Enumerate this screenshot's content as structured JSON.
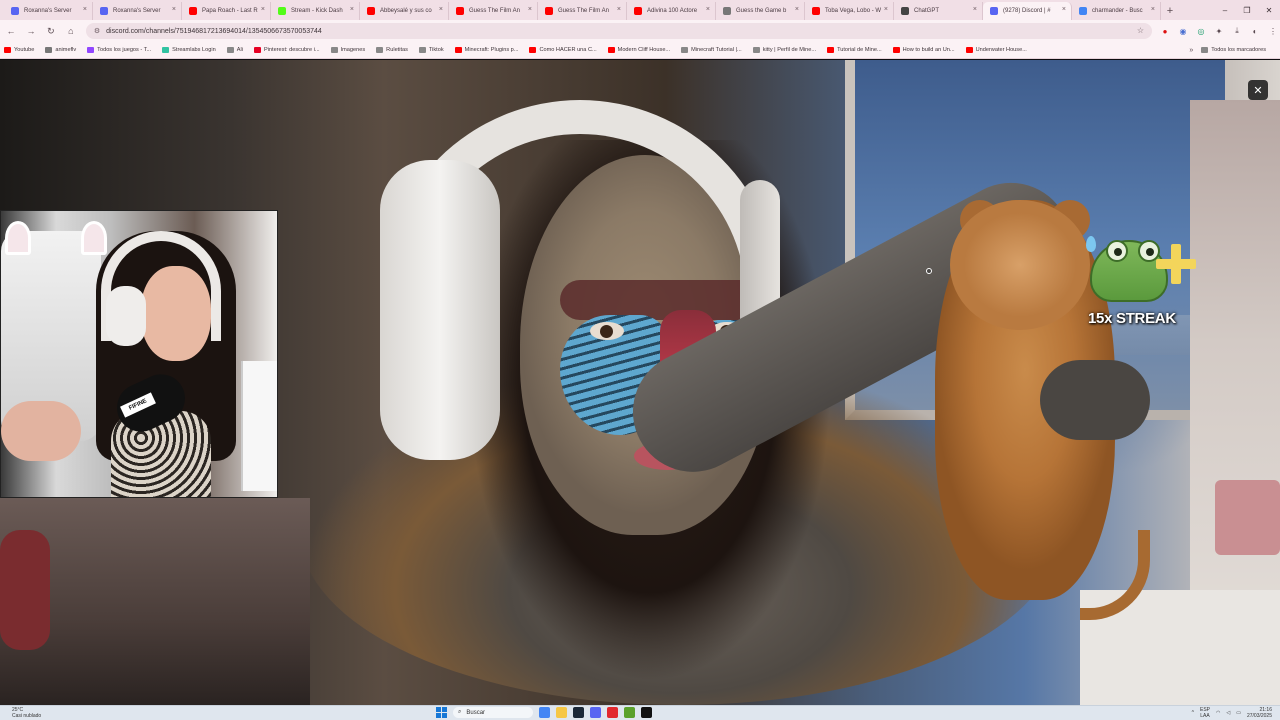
{
  "browser": {
    "tabs": [
      {
        "label": "Roxanna's Server",
        "color": "#5865f2"
      },
      {
        "label": "Roxanna's Server",
        "color": "#5865f2"
      },
      {
        "label": "Papa Roach - Last R",
        "color": "#ff0000"
      },
      {
        "label": "Stream - Kick Dash",
        "color": "#53fc18"
      },
      {
        "label": "Abbeysalé y sus co",
        "color": "#ff0000"
      },
      {
        "label": "Guess The Film An",
        "color": "#ff0000"
      },
      {
        "label": "Guess The Film An",
        "color": "#ff0000"
      },
      {
        "label": "Adivina 100 Actore",
        "color": "#ff0000"
      },
      {
        "label": "Guess the Game b",
        "color": "#777777"
      },
      {
        "label": "Toba Vega, Lobo - W",
        "color": "#ff0000"
      },
      {
        "label": "ChatGPT",
        "color": "#444444"
      },
      {
        "label": "(9278) Discord | #",
        "color": "#5865f2",
        "active": true
      },
      {
        "label": "charmander - Busc",
        "color": "#4285f4"
      }
    ],
    "url": "discord.com/channels/751946817213694014/1354506673570053744",
    "window_controls": {
      "minimize": "–",
      "maximize": "❐",
      "close": "✕"
    }
  },
  "bookmarks": {
    "items": [
      {
        "label": "Youtube",
        "color": "#ff0000"
      },
      {
        "label": "animeflv",
        "color": "#777777"
      },
      {
        "label": "Todos los juegos - T...",
        "color": "#9146ff"
      },
      {
        "label": "Streamlabs Login",
        "color": "#31c3a2"
      },
      {
        "label": "Ali",
        "color": "#888888"
      },
      {
        "label": "Pinterest: descubre i...",
        "color": "#e60023"
      },
      {
        "label": "Imagenes",
        "color": "#888888"
      },
      {
        "label": "Ruletitas",
        "color": "#888888"
      },
      {
        "label": "Tiktok",
        "color": "#888888"
      },
      {
        "label": "Minecraft: Plugins p...",
        "color": "#ff0000"
      },
      {
        "label": "Como HACER una C...",
        "color": "#ff0000"
      },
      {
        "label": "Modern Cliff House...",
        "color": "#ff0000"
      },
      {
        "label": "Minecraft Tutorial |...",
        "color": "#888888"
      },
      {
        "label": "kitty | Perfil de Mine...",
        "color": "#888888"
      },
      {
        "label": "Tutorial de Mine...",
        "color": "#ff0000"
      },
      {
        "label": "How to build an Un...",
        "color": "#ff0000"
      },
      {
        "label": "Underwater House...",
        "color": "#ff0000"
      }
    ],
    "more": "»",
    "all_label": "Todos los marcadores"
  },
  "viewer": {
    "close_icon": "✕",
    "streak_text": "15x STREAK",
    "mic_brand": "FIFINE"
  },
  "taskbar": {
    "weather_temp": "25°C",
    "weather_desc": "Casi nublado",
    "search_placeholder": "Buscar",
    "lang_top": "ESP",
    "lang_bottom": "LAA",
    "time": "21:16",
    "date": "27/03/2025",
    "apps": [
      {
        "name": "chrome-icon",
        "color": "#4285f4"
      },
      {
        "name": "file-explorer-icon",
        "color": "#f6c744"
      },
      {
        "name": "steam-icon",
        "color": "#1b2838"
      },
      {
        "name": "discord-icon",
        "color": "#5865f2"
      },
      {
        "name": "opera-icon",
        "color": "#e2292e"
      },
      {
        "name": "minecraft-icon",
        "color": "#5ba12c"
      },
      {
        "name": "capcut-icon",
        "color": "#111111"
      }
    ]
  }
}
